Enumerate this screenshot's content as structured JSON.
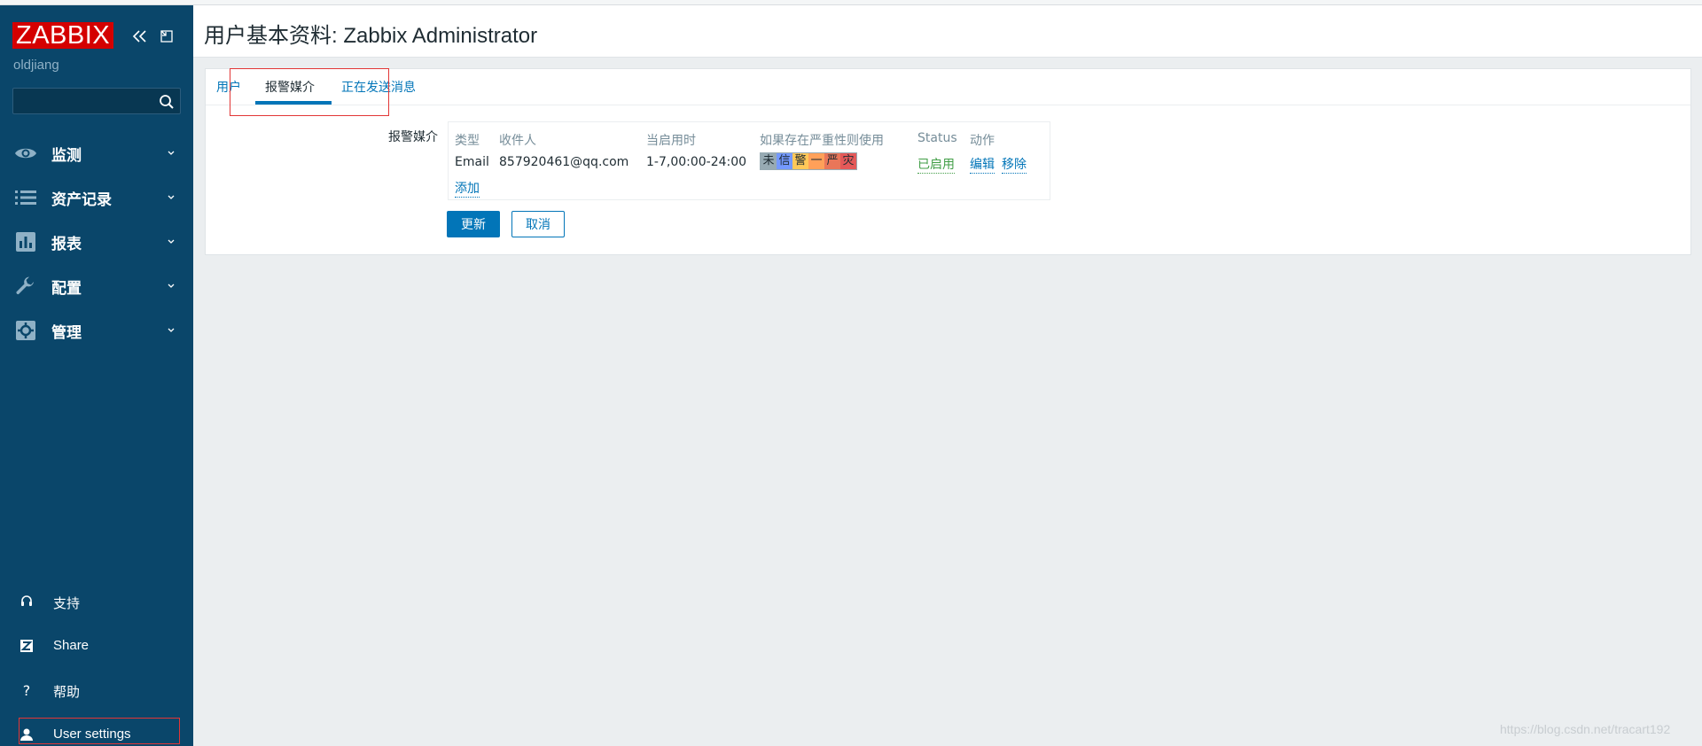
{
  "sidebar": {
    "logo": "ZABBIX",
    "username": "oldjiang",
    "search_placeholder": "",
    "menu": [
      {
        "label": "监测",
        "icon": "eye-icon"
      },
      {
        "label": "资产记录",
        "icon": "list-icon"
      },
      {
        "label": "报表",
        "icon": "bar-chart-icon"
      },
      {
        "label": "配置",
        "icon": "wrench-icon"
      },
      {
        "label": "管理",
        "icon": "gear-icon"
      }
    ],
    "bottom": [
      {
        "label": "支持",
        "icon": "headset-icon"
      },
      {
        "label": "Share",
        "icon": "share-z-icon"
      },
      {
        "label": "帮助",
        "icon": "help-icon"
      },
      {
        "label": "User settings",
        "icon": "user-icon"
      }
    ]
  },
  "header": {
    "title": "用户基本资料: Zabbix Administrator"
  },
  "tabs": [
    {
      "label": "用户",
      "active": false
    },
    {
      "label": "报警媒介",
      "active": true
    },
    {
      "label": "正在发送消息",
      "active": false
    }
  ],
  "media": {
    "form_label": "报警媒介",
    "columns": [
      "类型",
      "收件人",
      "当启用时",
      "如果存在严重性则使用",
      "Status",
      "动作"
    ],
    "rows": [
      {
        "type": "Email",
        "recipient": "857920461@qq.com",
        "when_active": "1-7,00:00-24:00",
        "severities": [
          {
            "label": "未",
            "color": "#97aab3"
          },
          {
            "label": "信",
            "color": "#7499ff"
          },
          {
            "label": "警",
            "color": "#ffc859"
          },
          {
            "label": "一",
            "color": "#ffa059"
          },
          {
            "label": "严",
            "color": "#e97659"
          },
          {
            "label": "灾",
            "color": "#e45959"
          }
        ],
        "status": "已启用",
        "action_edit": "编辑",
        "action_remove": "移除"
      }
    ],
    "add_label": "添加"
  },
  "buttons": {
    "update": "更新",
    "cancel": "取消"
  },
  "watermark": "https://blog.csdn.net/tracart192",
  "colors": {
    "sidebar_bg": "#0a466a",
    "accent": "#0275b8",
    "logo_bg": "#d40000",
    "highlight": "#e23636",
    "status_enabled": "#429e47"
  }
}
